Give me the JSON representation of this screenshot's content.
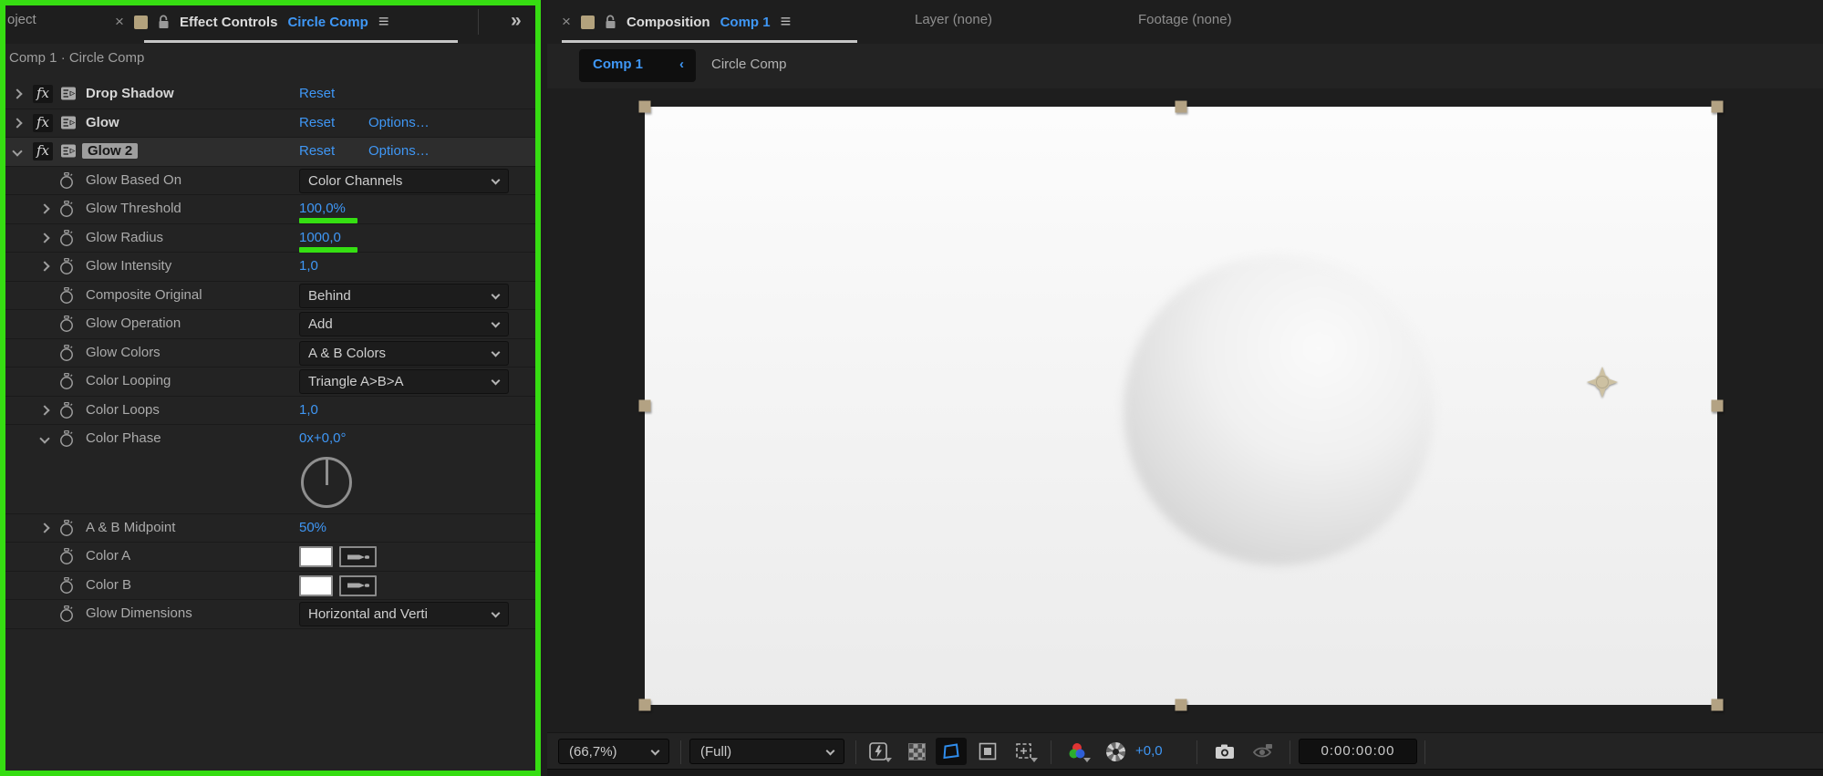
{
  "colors": {
    "accent_blue": "#3f97f5",
    "annotation_green": "#36dd12",
    "handle_tan": "#b3a283",
    "swatch_white": "#ffffff"
  },
  "effect_controls": {
    "partial_left_tab": "oject",
    "tab": {
      "close": "×",
      "title": "Effect Controls",
      "target": "Circle Comp",
      "menu": "≡"
    },
    "expander": "»",
    "breadcrumb": "Comp 1 · Circle Comp",
    "rows": [
      {
        "kind": "effect",
        "chevron": "collapsed",
        "name": "Drop Shadow",
        "links": [
          "Reset"
        ]
      },
      {
        "kind": "effect",
        "chevron": "collapsed",
        "name": "Glow",
        "links": [
          "Reset",
          "Options…"
        ]
      },
      {
        "kind": "effect",
        "chevron": "expanded",
        "name": "Glow 2",
        "selected": true,
        "links": [
          "Reset",
          "Options…"
        ]
      },
      {
        "kind": "dropdown",
        "name": "Glow Based On",
        "value": "Color Channels"
      },
      {
        "kind": "value",
        "chevron": "collapsed",
        "name": "Glow Threshold",
        "value": "100,0%",
        "annotated": true
      },
      {
        "kind": "value",
        "chevron": "collapsed",
        "name": "Glow Radius",
        "value": "1000,0",
        "annotated": true
      },
      {
        "kind": "value",
        "chevron": "collapsed",
        "name": "Glow Intensity",
        "value": "1,0"
      },
      {
        "kind": "dropdown",
        "name": "Composite Original",
        "value": "Behind"
      },
      {
        "kind": "dropdown",
        "name": "Glow Operation",
        "value": "Add"
      },
      {
        "kind": "dropdown",
        "name": "Glow Colors",
        "value": "A & B Colors"
      },
      {
        "kind": "dropdown",
        "name": "Color Looping",
        "value": "Triangle A>B>A"
      },
      {
        "kind": "value",
        "chevron": "collapsed",
        "name": "Color Loops",
        "value": "1,0"
      },
      {
        "kind": "value",
        "chevron": "expanded",
        "name": "Color Phase",
        "value": "0x+0,0°",
        "no_sep": true
      },
      {
        "kind": "dial"
      },
      {
        "kind": "value",
        "chevron": "collapsed",
        "name": "A & B Midpoint",
        "value": "50%"
      },
      {
        "kind": "color",
        "name": "Color A",
        "swatch": "#ffffff"
      },
      {
        "kind": "color",
        "name": "Color B",
        "swatch": "#ffffff"
      },
      {
        "kind": "dropdown",
        "name": "Glow Dimensions",
        "value": "Horizontal and Verti"
      }
    ]
  },
  "composition": {
    "tab": {
      "close": "×",
      "title": "Composition",
      "target": "Comp 1",
      "menu": "≡"
    },
    "other_tabs": [
      "Layer (none)",
      "Footage (none)"
    ],
    "viewer_tab": {
      "label": "Comp 1",
      "chevron": "‹"
    },
    "viewer_breadcrumb": "Circle Comp",
    "toolbar": {
      "zoom": "(66,7%)",
      "resolution": "(Full)",
      "exposure": "+0,0",
      "timecode": "0:00:00:00"
    }
  },
  "icons": {
    "panel": [
      "close-icon",
      "panel-lock-icon",
      "panel-menu-icon",
      "panel-expander-icon"
    ],
    "effect_controls": [
      "fx-icon",
      "effect-icon",
      "stopwatch-icon",
      "expand-chevron-icon",
      "dropdown-chevron-icon",
      "eyedropper-icon",
      "dial-icon"
    ],
    "composition": [
      "fast-preview-icon",
      "transparency-grid-icon",
      "mask-visibility-icon",
      "region-of-interest-icon",
      "grid-guides-icon",
      "channels-icon",
      "exposure-reset-icon",
      "snapshot-icon",
      "show-snapshot-icon",
      "anchor-point-icon",
      "selection-handle"
    ]
  }
}
